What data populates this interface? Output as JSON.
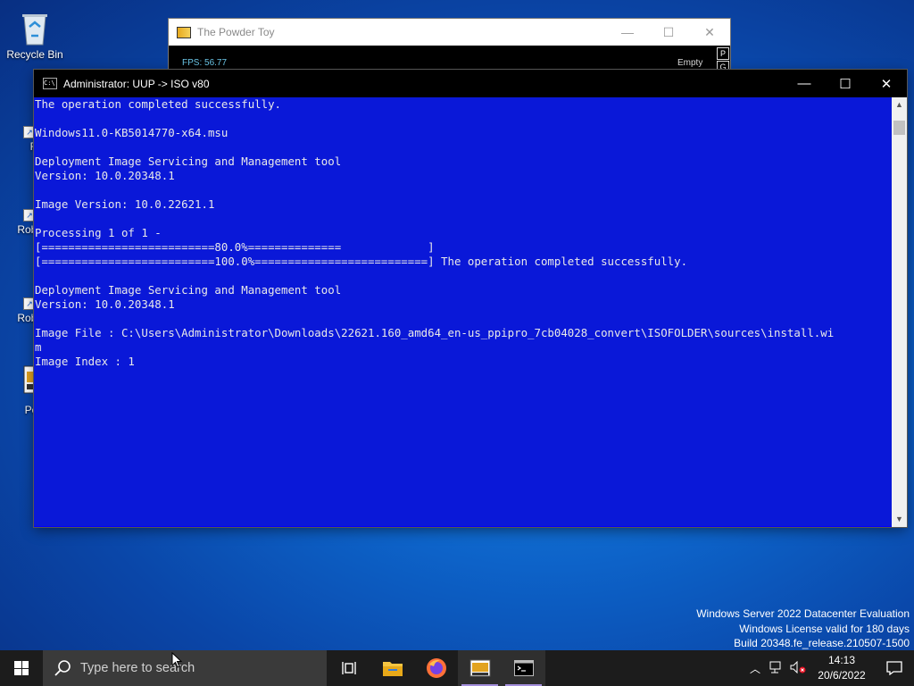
{
  "desktop": {
    "icons": [
      {
        "label": "Recycle Bin"
      },
      {
        "label": "Fire"
      },
      {
        "label": "Roblox"
      },
      {
        "label": "Roblox"
      },
      {
        "label": "Pov"
      }
    ]
  },
  "powder_toy": {
    "title": "The Powder Toy",
    "fps": "FPS: 56.77",
    "status": "Empty",
    "side_buttons": [
      "P",
      "G"
    ]
  },
  "cmd": {
    "title": "Administrator:  UUP -> ISO v80",
    "lines": [
      "The operation completed successfully.",
      "",
      "Windows11.0-KB5014770-x64.msu",
      "",
      "Deployment Image Servicing and Management tool",
      "Version: 10.0.20348.1",
      "",
      "Image Version: 10.0.22621.1",
      "",
      "Processing 1 of 1 -",
      "[==========================80.0%==============             ]",
      "[==========================100.0%==========================] The operation completed successfully.",
      "",
      "Deployment Image Servicing and Management tool",
      "Version: 10.0.20348.1",
      "",
      "Image File : C:\\Users\\Administrator\\Downloads\\22621.160_amd64_en-us_ppipro_7cb04028_convert\\ISOFOLDER\\sources\\install.wi",
      "m",
      "Image Index : 1"
    ]
  },
  "watermark": {
    "line1": "Windows Server 2022 Datacenter Evaluation",
    "line2": "Windows License valid for 180 days",
    "line3": "Build 20348.fe_release.210507-1500"
  },
  "taskbar": {
    "search_placeholder": "Type here to search",
    "apps": [
      "task-view-icon",
      "file-explorer-icon",
      "firefox-icon",
      "powder-toy-icon",
      "command-prompt-icon"
    ],
    "clock_time": "14:13",
    "clock_date": "20/6/2022"
  },
  "colors": {
    "cmd_background": "#0a18d8",
    "cmd_text": "#e9e9e9",
    "taskbar": "#1c1c1c",
    "accent_underline": "#a48fdc"
  }
}
